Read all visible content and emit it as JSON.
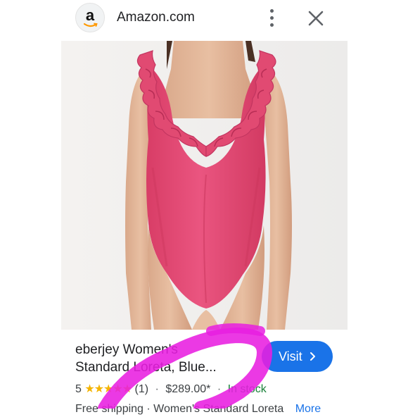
{
  "header": {
    "favicon_letter": "a",
    "site_name": "Amazon.com"
  },
  "product": {
    "title_line1": "eberjey Women's",
    "title_line2": "Standard Loreta, Blue...",
    "visit_label": "Visit",
    "rating_value": "5",
    "stars": "★★★★★",
    "rating_stars_value": 5,
    "rating_stars_max": 5,
    "review_count": "(1)",
    "separator": "·",
    "price": "$289.00*",
    "stock_status": "In stock",
    "cut_row_text": "Free shipping · Women's Standard Loreta",
    "more_label": "More"
  },
  "colors": {
    "swimsuit": "#e64a73",
    "accent_blue": "#1a73e8",
    "stock_green": "#188038",
    "star_gold": "#f4b400",
    "marker": "#e81ee0"
  }
}
